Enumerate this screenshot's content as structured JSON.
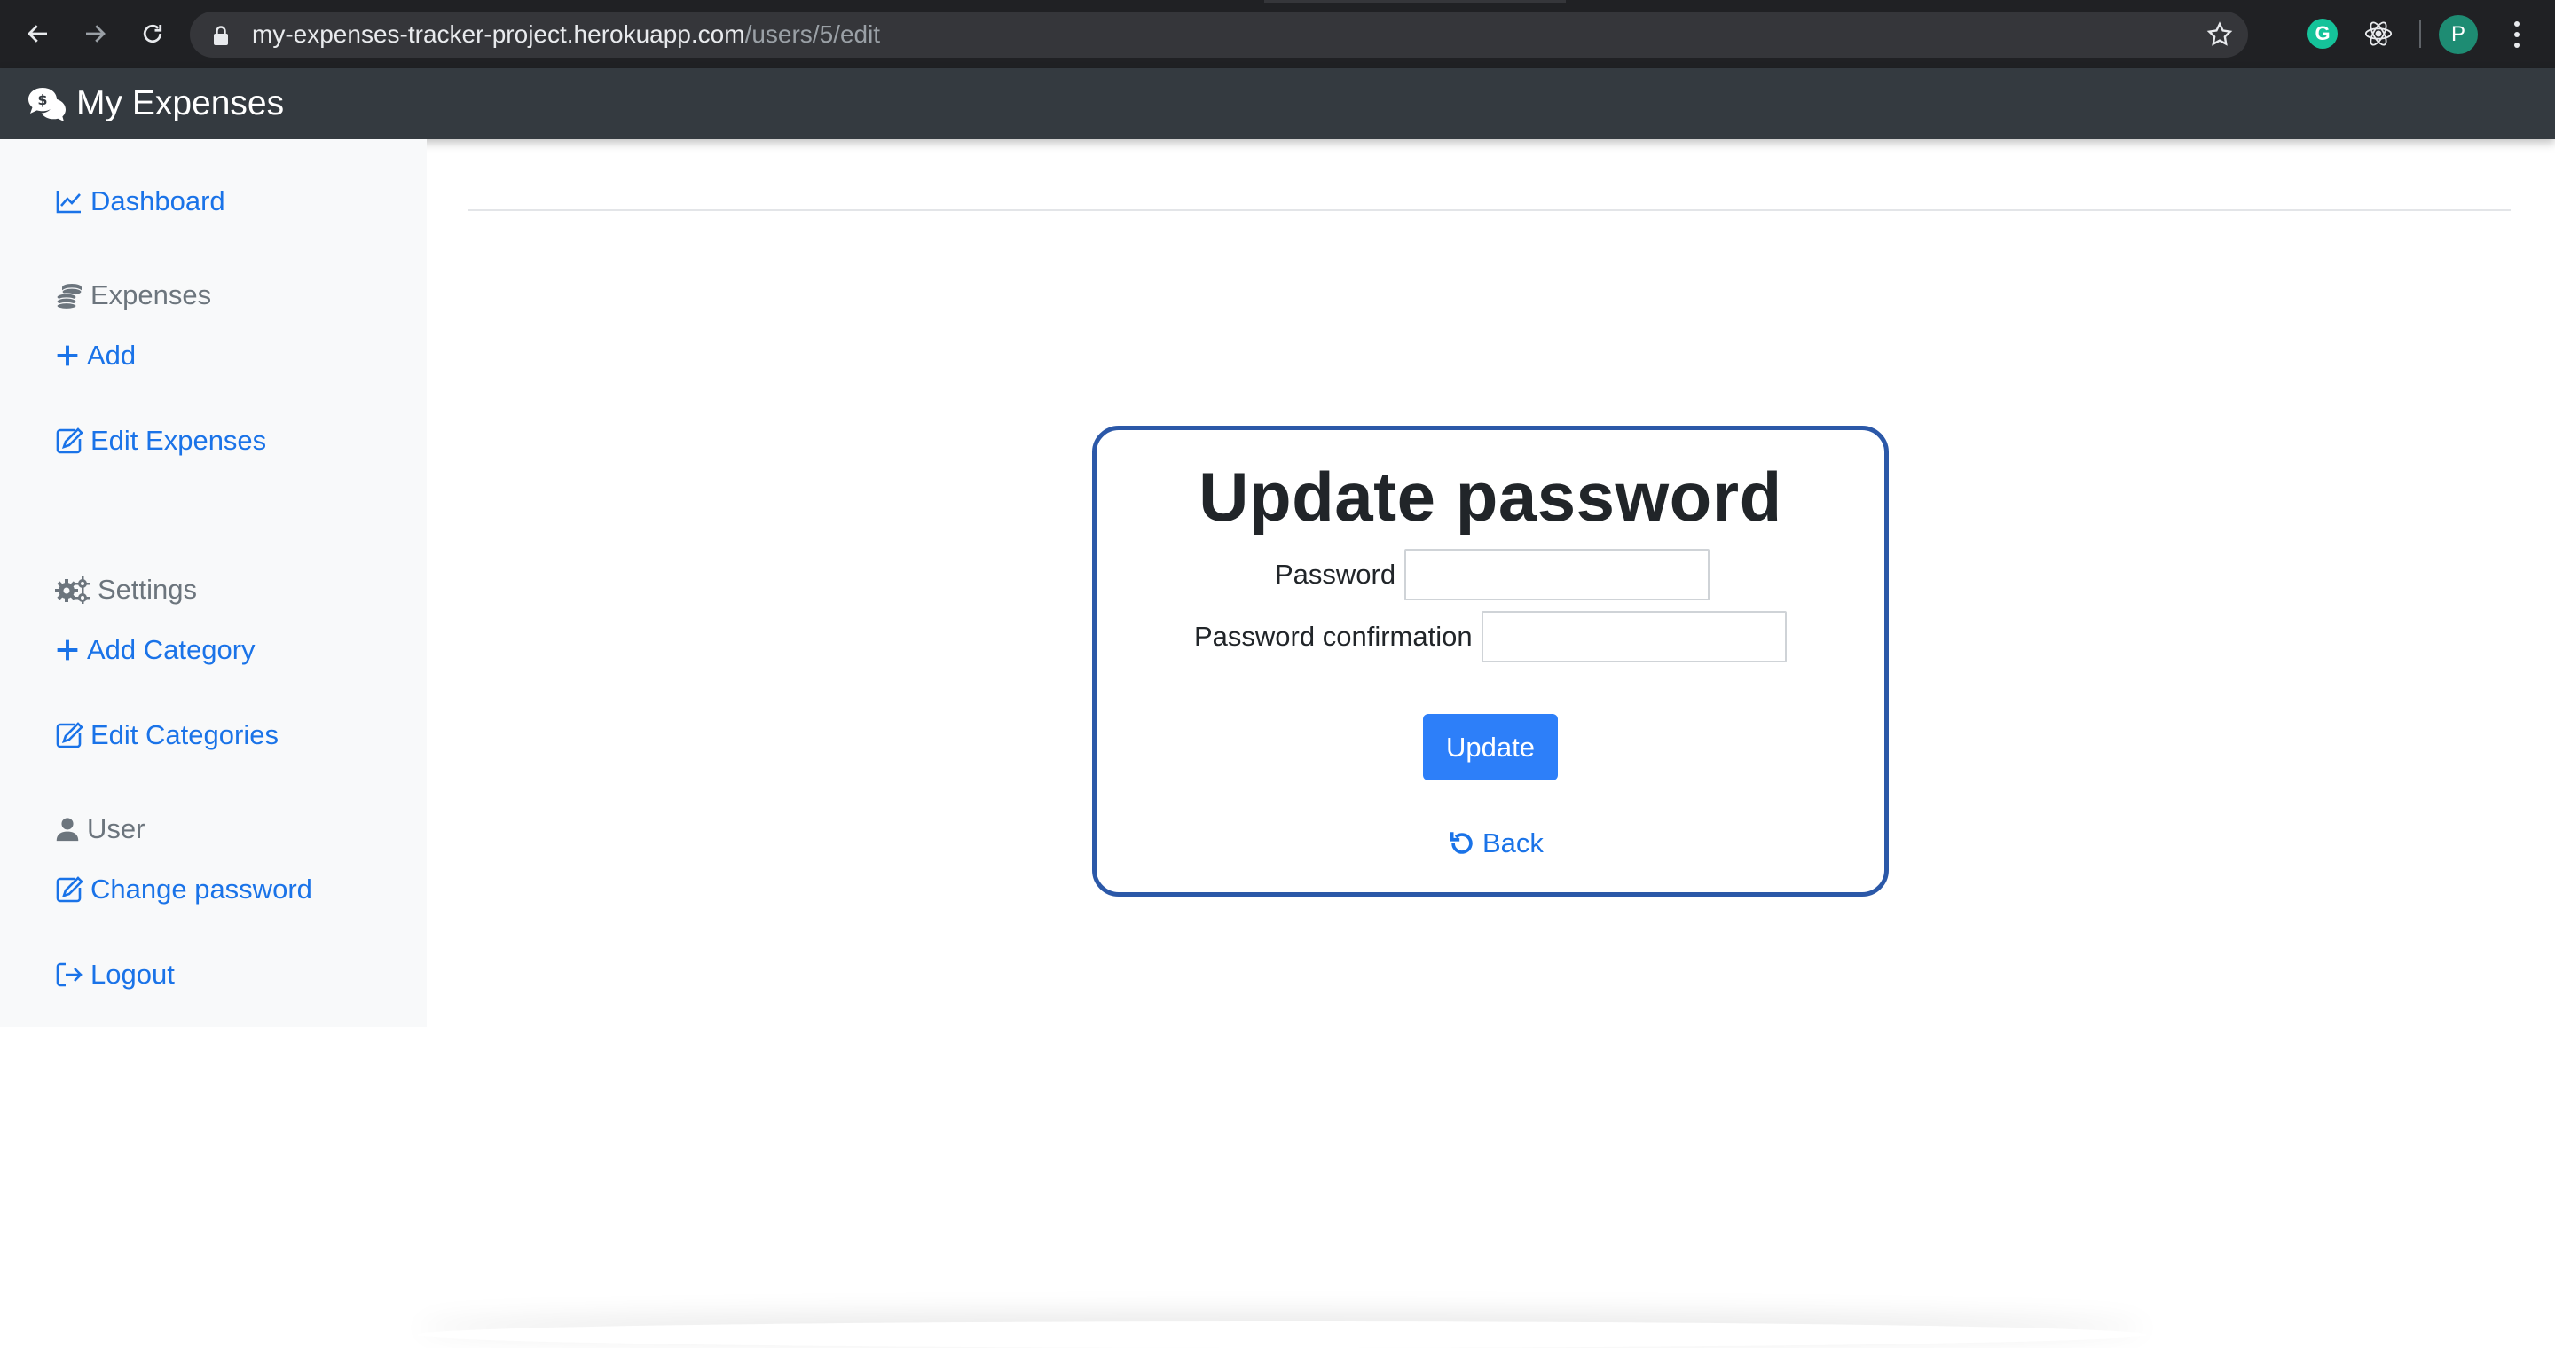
{
  "browser": {
    "url_host": "my-expenses-tracker-project.herokuapp.com",
    "url_path": "/users/5/edit",
    "profile_initial": "P",
    "extension_g": "G",
    "icons": [
      "back-arrow-icon",
      "forward-arrow-icon",
      "reload-icon",
      "lock-icon",
      "star-icon",
      "grammarly-icon",
      "react-devtools-icon",
      "more-vert-icon"
    ]
  },
  "navbar": {
    "brand": "My Expenses",
    "brand_icon": "money-chat-icon"
  },
  "sidebar": {
    "dashboard": "Dashboard",
    "expenses_heading": "Expenses",
    "add": "Add",
    "edit_expenses": "Edit Expenses",
    "settings_heading": "Settings",
    "add_category": "Add Category",
    "edit_categories": "Edit Categories",
    "user_heading": "User",
    "change_password": "Change password",
    "logout": "Logout"
  },
  "form": {
    "title": "Update password",
    "password_label": "Password",
    "password_value": "",
    "confirmation_label": "Password confirmation",
    "confirmation_value": "",
    "submit_label": "Update",
    "back_label": "Back"
  },
  "colors": {
    "link": "#1a73e8",
    "navbar_bg": "#343a40",
    "card_border": "#2b58a8",
    "button_bg": "#2d7ff9",
    "sidebar_bg": "#f8f9fa"
  }
}
